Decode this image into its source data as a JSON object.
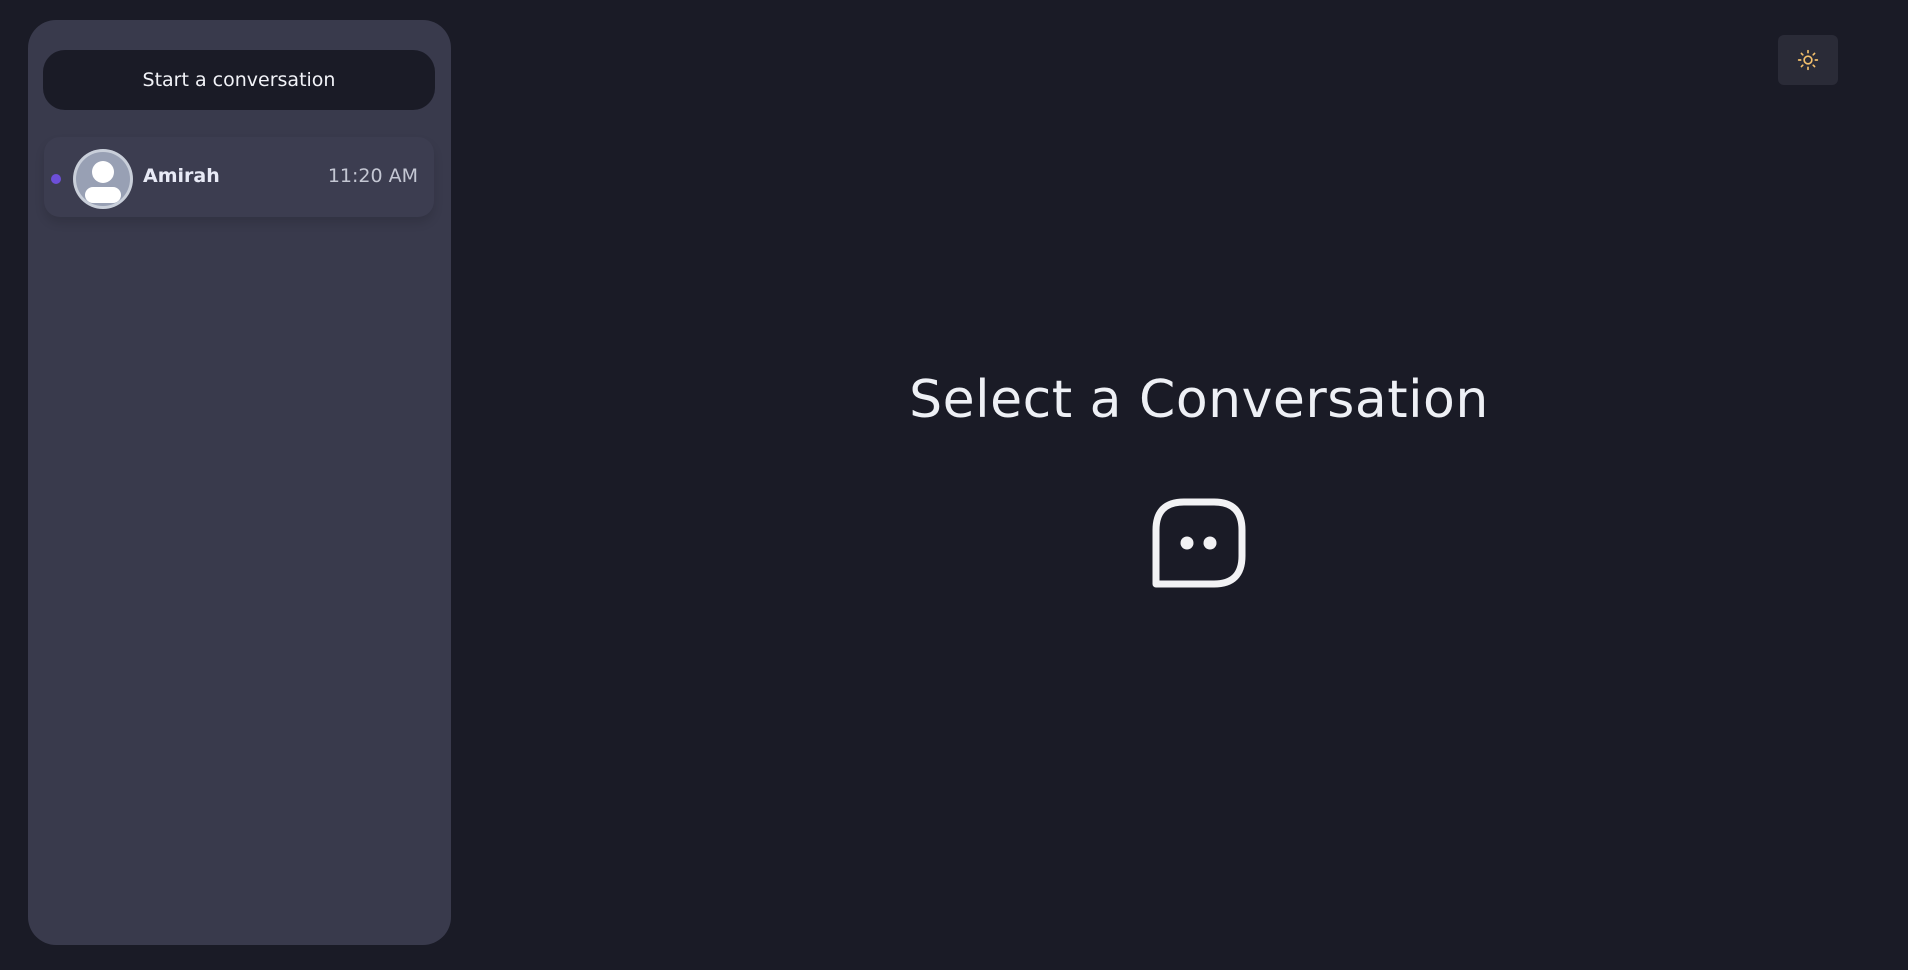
{
  "sidebar": {
    "start_button_label": "Start a conversation",
    "conversations": [
      {
        "name": "Amirah",
        "time": "11:20 AM",
        "unread": true,
        "avatar_icon": "user-avatar-icon"
      }
    ]
  },
  "header": {
    "theme_toggle_icon": "sun-icon"
  },
  "main": {
    "empty_title": "Select a Conversation",
    "empty_icon": "chat-bubble-icon"
  },
  "colors": {
    "background": "#1a1b26",
    "sidebar": "#393a4c",
    "accent_unread": "#6d4fd8",
    "sun": "#f5c16c"
  }
}
